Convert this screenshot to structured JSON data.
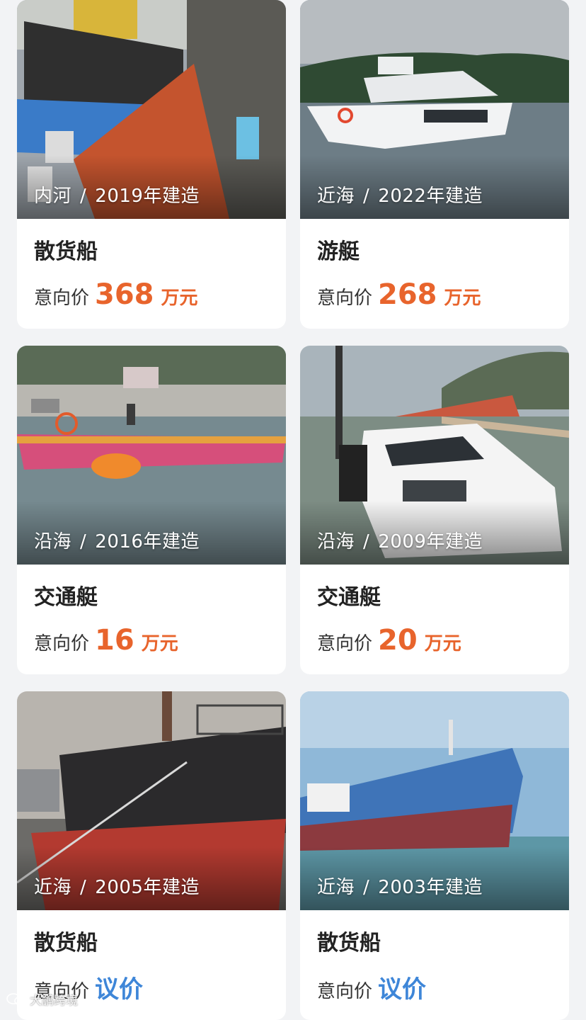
{
  "listings": [
    {
      "waters": "内河",
      "year": "2019年建造",
      "name": "散货船",
      "price_label": "意向价",
      "price": "368",
      "unit": "万元"
    },
    {
      "waters": "近海",
      "year": "2022年建造",
      "name": "游艇",
      "price_label": "意向价",
      "price": "268",
      "unit": "万元"
    },
    {
      "waters": "沿海",
      "year": "2016年建造",
      "name": "交通艇",
      "price_label": "意向价",
      "price": "16",
      "unit": "万元"
    },
    {
      "waters": "沿海",
      "year": "2009年建造",
      "name": "交通艇",
      "price_label": "意向价",
      "price": "20",
      "unit": "万元"
    },
    {
      "waters": "近海",
      "year": "2005年建造",
      "name": "散货船",
      "price_label": "意向价",
      "negotiable": "议价"
    },
    {
      "waters": "近海",
      "year": "2003年建造",
      "name": "散货船",
      "price_label": "意向价",
      "negotiable": "议价"
    }
  ],
  "separator": "/",
  "watermark": "大鹏跨境",
  "colors": {
    "price": "#e8642c",
    "negotiable": "#3e86d8",
    "background": "#f2f3f5"
  }
}
